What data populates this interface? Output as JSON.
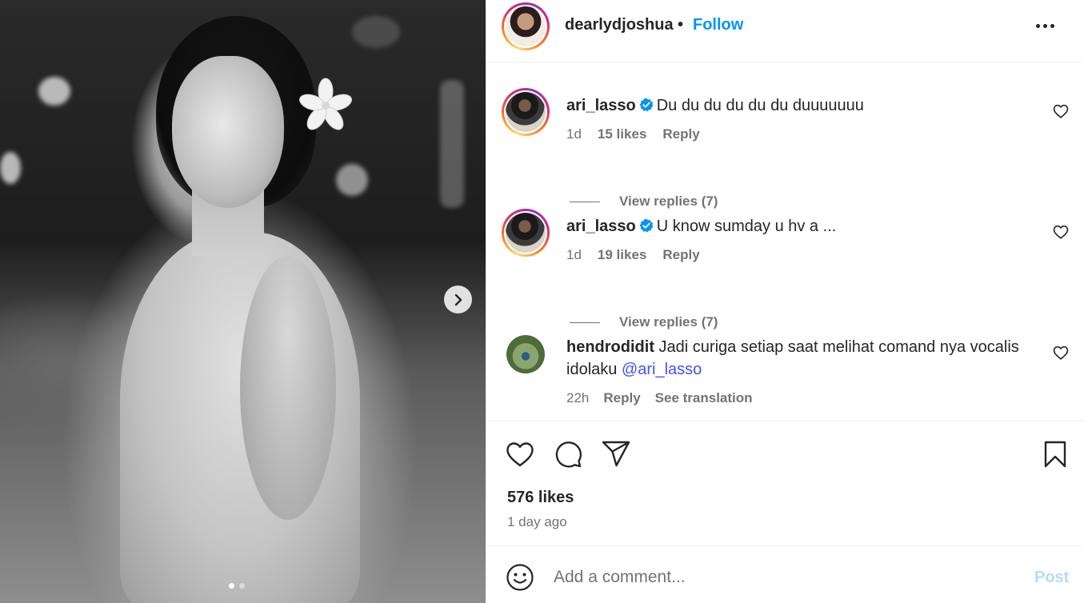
{
  "post": {
    "author": "dearlydjoshua",
    "separator": "•",
    "follow_label": "Follow",
    "more_icon": "more-horizontal-icon"
  },
  "media": {
    "next_icon": "chevron-right-icon",
    "carousel_total": 2,
    "carousel_active": 1
  },
  "comments": [
    {
      "username": "ari_lasso",
      "verified": true,
      "text": "Du du du du du du duuuuuuu",
      "age": "1d",
      "likes": "15 likes",
      "reply_label": "Reply",
      "view_replies": "View replies (7)"
    },
    {
      "username": "ari_lasso",
      "verified": true,
      "text": "U know sumday u hv a ...",
      "age": "1d",
      "likes": "19 likes",
      "reply_label": "Reply",
      "view_replies": "View replies (7)"
    },
    {
      "username": "hendrodidit",
      "verified": false,
      "text": "Jadi curiga setiap saat melihat comand nya vocalis idolaku",
      "mention": "@ari_lasso",
      "age": "22h",
      "reply_label": "Reply",
      "translate_label": "See translation"
    }
  ],
  "actions": {
    "likes": "576 likes",
    "time_ago": "1 day ago"
  },
  "composer": {
    "placeholder": "Add a comment...",
    "post_label": "Post"
  },
  "colors": {
    "follow": "#0095f6",
    "mention": "#4150f7",
    "post_disabled": "#b3dbff",
    "verified": "#0095f6"
  }
}
